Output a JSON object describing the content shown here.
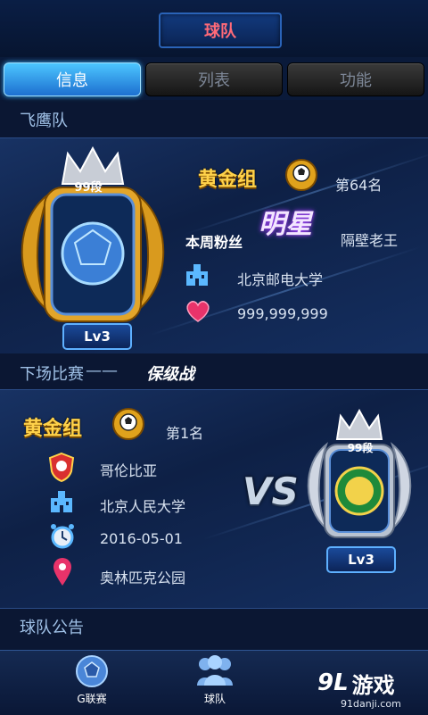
{
  "header": {
    "title": "球队"
  },
  "tabs": [
    {
      "label": "信息",
      "active": true
    },
    {
      "label": "列表",
      "active": false
    },
    {
      "label": "功能",
      "active": false
    }
  ],
  "team": {
    "name": "飞鹰队",
    "rank_badge": "99段",
    "level": "Lv3",
    "group": "黄金组",
    "rank_text": "第64名",
    "weekly_fan_label": "本周粉丝",
    "star_tag": "明星",
    "star_fan": "隔壁老王",
    "school": "北京邮电大学",
    "fans": "999,999,999"
  },
  "next_match": {
    "label": "下场比赛",
    "dash": "——",
    "type": "保级战",
    "group": "黄金组",
    "rank_text": "第1名",
    "opponent": "哥伦比亚",
    "school": "北京人民大学",
    "date": "2016-05-01",
    "venue": "奥林匹克公园",
    "vs": "VS",
    "opponent_rank_badge": "99段",
    "opponent_level": "Lv3"
  },
  "announcement": {
    "label": "球队公告"
  },
  "bottom_nav": [
    {
      "label": "G联赛",
      "icon": "soccer-ball-icon"
    },
    {
      "label": "球队",
      "icon": "team-icon"
    }
  ],
  "watermark": {
    "text": "游戏",
    "mark": "9L",
    "url": "91danji.com"
  },
  "colors": {
    "accent": "#3cb6ff",
    "gold": "#ffd24a",
    "title_red": "#ff6a78"
  }
}
